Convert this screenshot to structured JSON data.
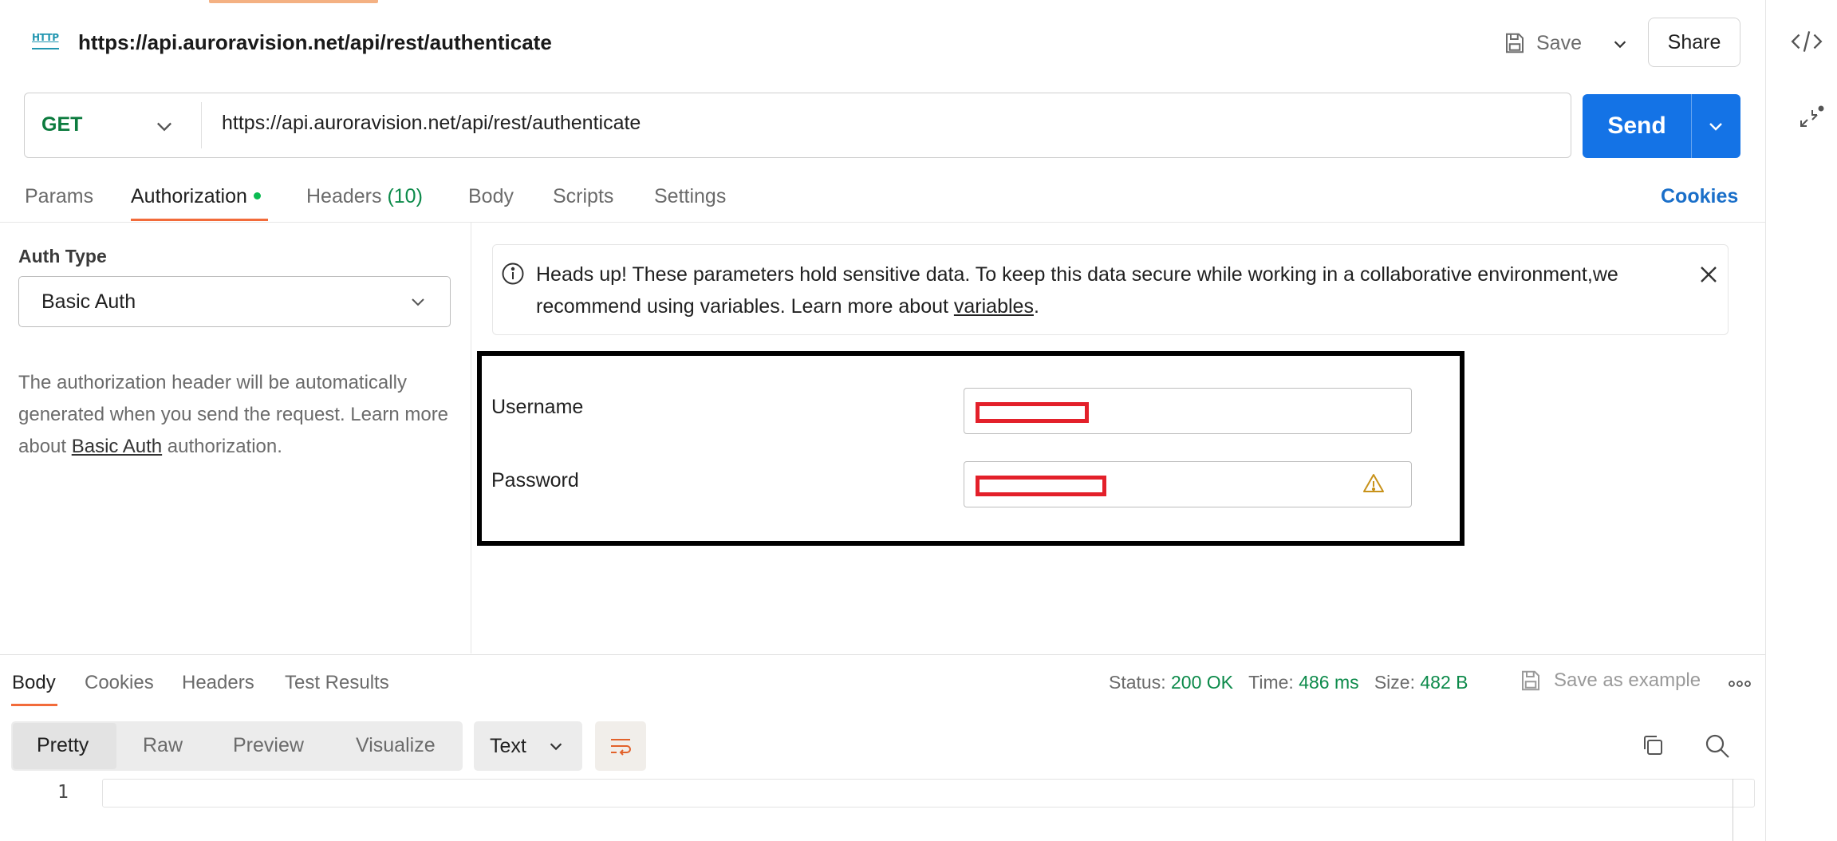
{
  "request": {
    "title": "https://api.auroravision.net/api/rest/authenticate",
    "method": "GET",
    "url": "https://api.auroravision.net/api/rest/authenticate",
    "http_icon_text": "HTTP"
  },
  "toolbar": {
    "save_label": "Save",
    "share_label": "Share",
    "send_label": "Send"
  },
  "request_tabs": {
    "params": "Params",
    "authorization": "Authorization",
    "headers": "Headers",
    "headers_count": "(10)",
    "body": "Body",
    "scripts": "Scripts",
    "settings": "Settings",
    "cookies": "Cookies"
  },
  "auth": {
    "type_label": "Auth Type",
    "type_value": "Basic Auth",
    "desc_before": "The authorization header will be automatically generated when you send the request. Learn more about ",
    "desc_link": "Basic Auth",
    "desc_after": " authorization."
  },
  "banner": {
    "text_before": "Heads up! These parameters hold sensitive data. To keep this data secure while working in a collaborative environment,we recommend using variables. Learn more about ",
    "link": "variables",
    "text_after": "."
  },
  "credentials": {
    "username_label": "Username",
    "password_label": "Password",
    "username_value": "",
    "password_value": ""
  },
  "response": {
    "tabs": [
      "Body",
      "Cookies",
      "Headers",
      "Test Results"
    ],
    "status_label": "Status:",
    "status_value": "200 OK",
    "time_label": "Time:",
    "time_value": "486 ms",
    "size_label": "Size:",
    "size_value": "482 B",
    "save_example": "Save as example",
    "views": [
      "Pretty",
      "Raw",
      "Preview",
      "Visualize"
    ],
    "format": "Text",
    "line_number": "1"
  },
  "colors": {
    "accent_orange": "#f26b3a",
    "send_blue": "#1473e6",
    "method_green": "#0c7b3e",
    "status_green": "#0c8a4a",
    "redaction_red": "#e3202a"
  }
}
